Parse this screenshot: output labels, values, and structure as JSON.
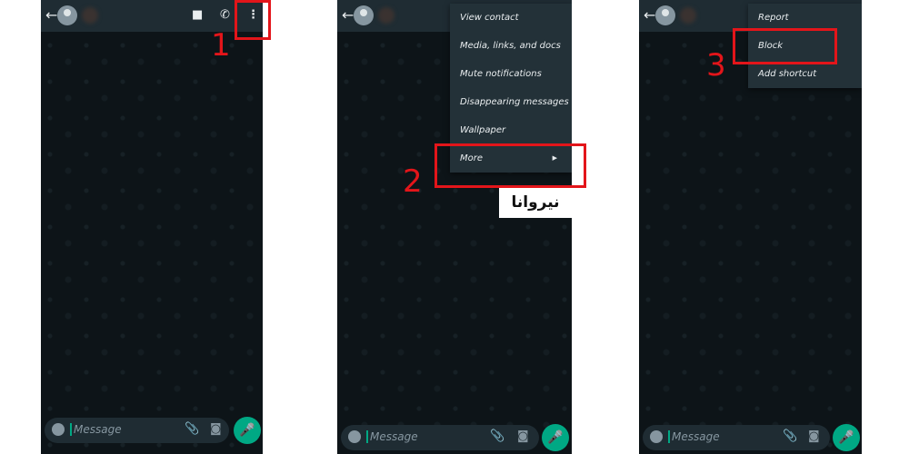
{
  "panels": [
    {
      "step": "1",
      "message_placeholder": "Message"
    },
    {
      "step": "2",
      "message_placeholder": "Message",
      "menu": [
        "View contact",
        "Media, links, and docs",
        "Mute notifications",
        "Disappearing messages",
        "Wallpaper",
        "More"
      ]
    },
    {
      "step": "3",
      "message_placeholder": "Message",
      "menu": [
        "Report",
        "Block",
        "Add shortcut"
      ]
    }
  ],
  "logo_text": "نیروانا",
  "colors": {
    "header": "#1f2c33",
    "accent": "#00a884",
    "highlight": "#e3151a",
    "menu": "#233138"
  }
}
